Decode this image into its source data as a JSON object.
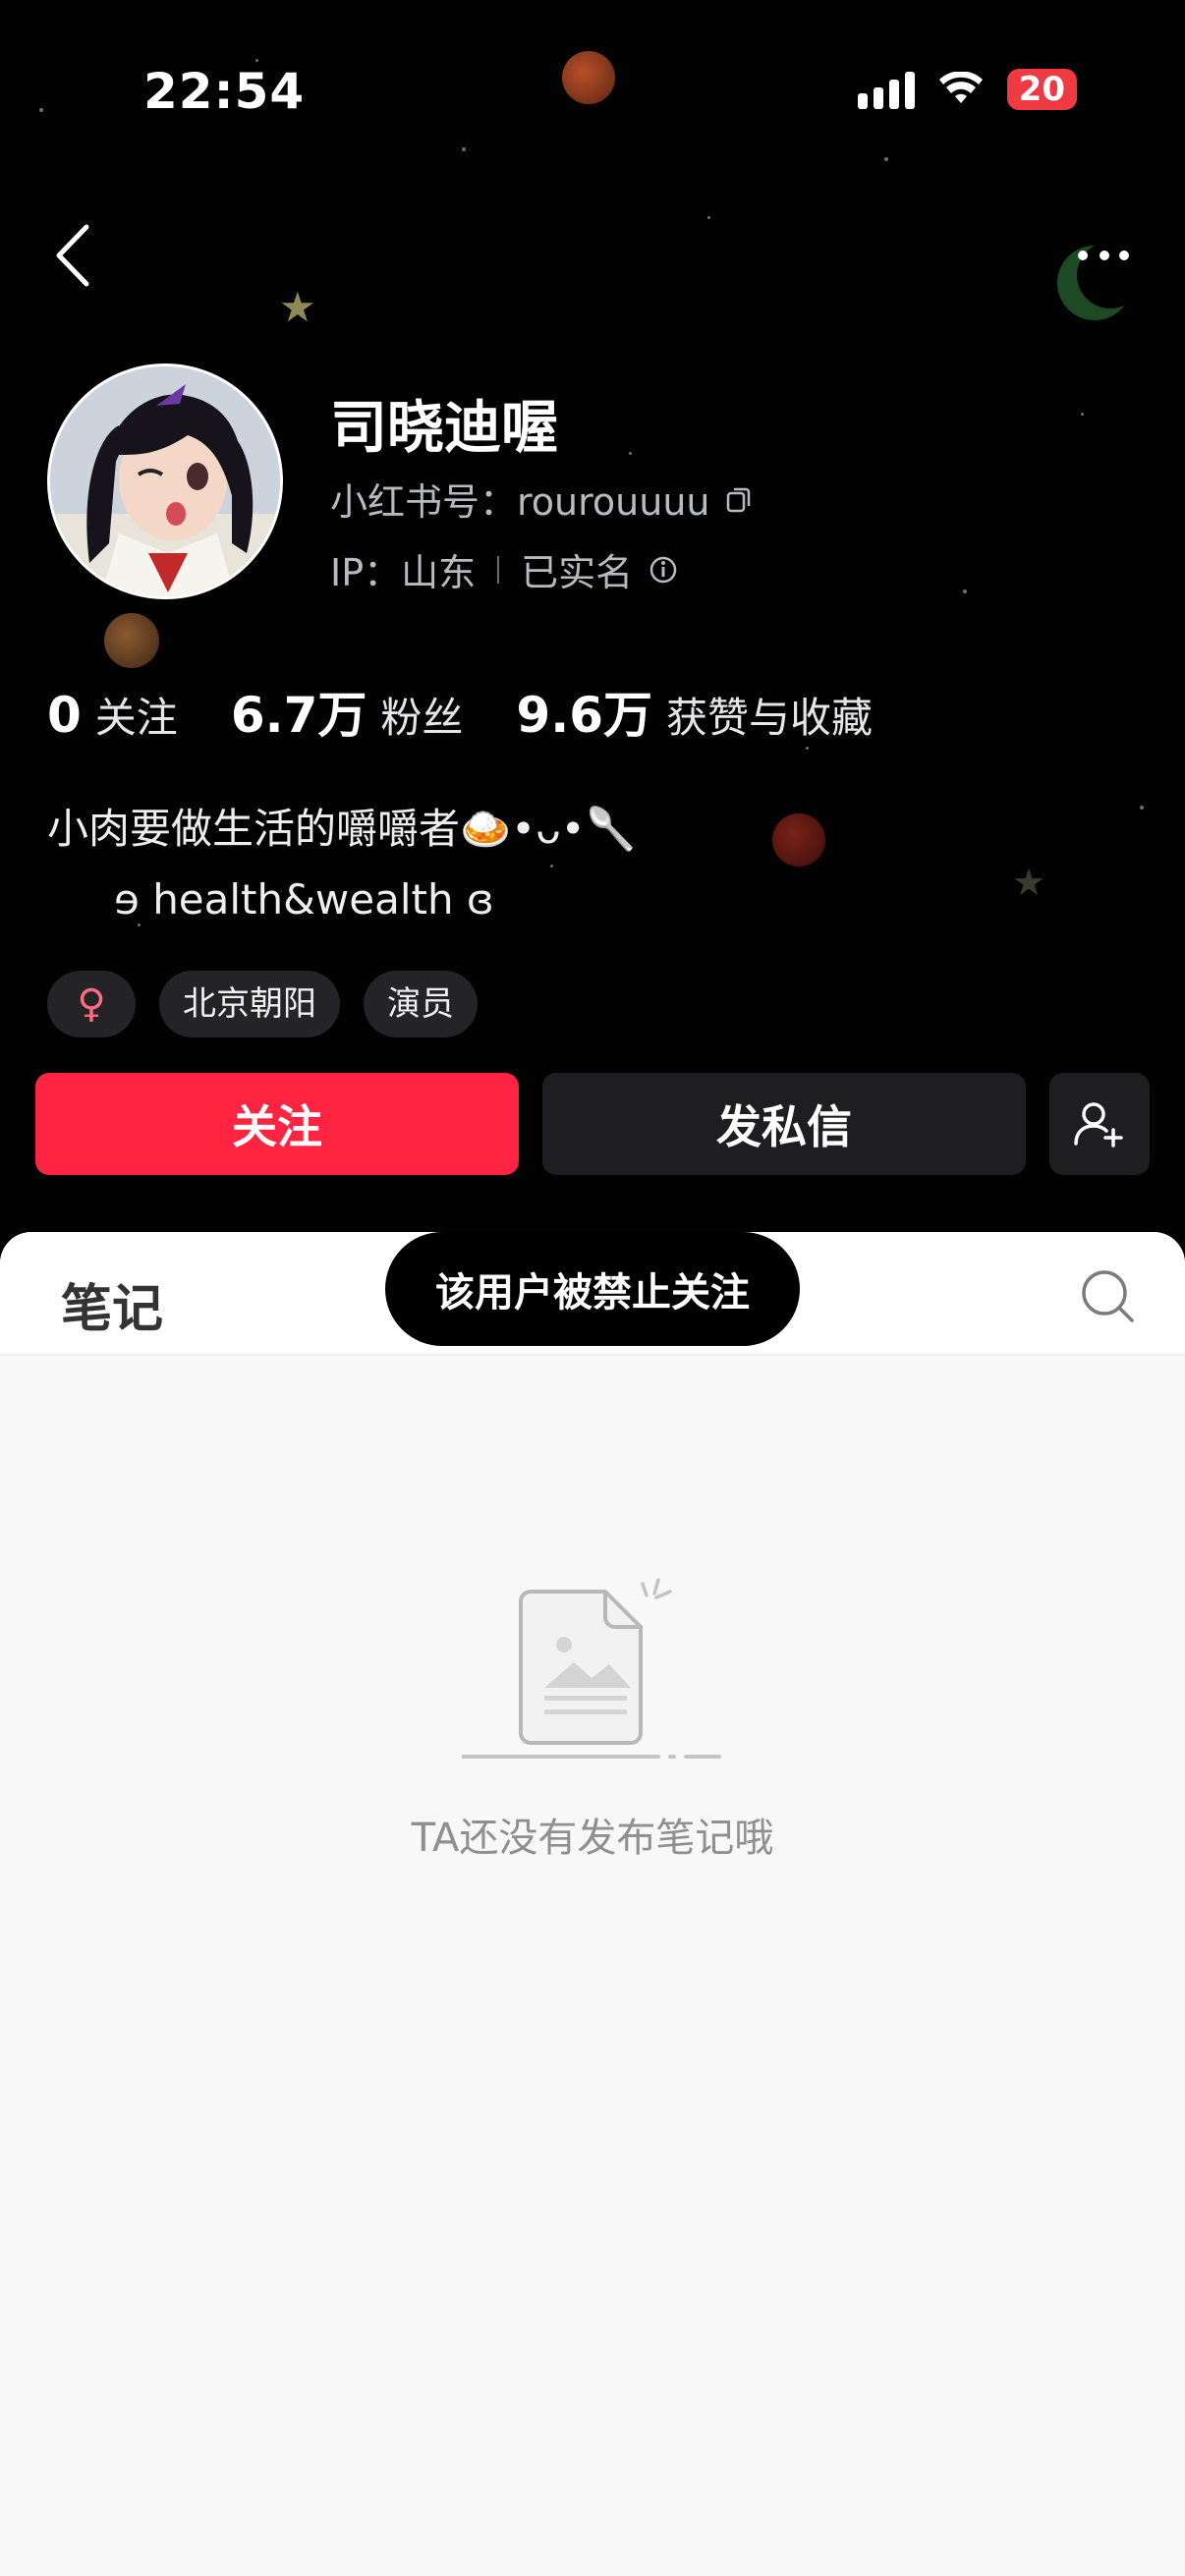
{
  "status_bar": {
    "time": "22:54",
    "battery": "20"
  },
  "profile": {
    "nickname": "司晓迪喔",
    "id_label": "小红书号：",
    "id_value": "rourouuuu",
    "ip_label": "IP：",
    "ip_value": "山东",
    "verified_label": "已实名"
  },
  "stats": [
    {
      "value": "0",
      "label": "关注"
    },
    {
      "value": "6.7万",
      "label": "粉丝"
    },
    {
      "value": "9.6万",
      "label": "获赞与收藏"
    }
  ],
  "bio": {
    "line1": "小肉要做生活的嚼嚼者🍛•ᴗ•🥄",
    "line2": "ɘ health&wealth ɞ"
  },
  "tags": {
    "gender": "♀",
    "location": "北京朝阳",
    "occupation": "演员"
  },
  "actions": {
    "follow": "关注",
    "message": "发私信"
  },
  "tabs": {
    "notes": "笔记"
  },
  "toast": "该用户被禁止关注",
  "empty_state": {
    "text": "TA还没有发布笔记哦"
  },
  "colors": {
    "accent": "#ff2442",
    "hero_background": "#020203",
    "content_background": "#f8f8f8"
  },
  "icons": [
    "back-icon",
    "moon-icon",
    "copy-icon",
    "info-icon",
    "add-friend-icon",
    "search-icon",
    "empty-note-icon"
  ]
}
